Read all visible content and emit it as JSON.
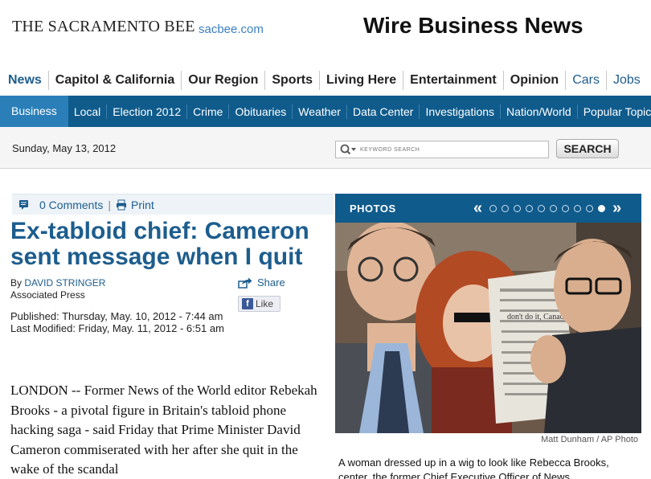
{
  "masthead": {
    "logo": "THE SACRAMENTO BEE",
    "logo_sub": "sacbee.com",
    "section_title": "Wire Business News"
  },
  "primary_nav": [
    {
      "label": "News"
    },
    {
      "label": "Capitol & California"
    },
    {
      "label": "Our Region"
    },
    {
      "label": "Sports"
    },
    {
      "label": "Living Here"
    },
    {
      "label": "Entertainment"
    },
    {
      "label": "Opinion"
    },
    {
      "label": "Cars"
    },
    {
      "label": "Jobs"
    }
  ],
  "secondary_nav": [
    {
      "label": "Business"
    },
    {
      "label": "Local"
    },
    {
      "label": "Election 2012"
    },
    {
      "label": "Crime"
    },
    {
      "label": "Obituaries"
    },
    {
      "label": "Weather"
    },
    {
      "label": "Data Center"
    },
    {
      "label": "Investigations"
    },
    {
      "label": "Nation/World"
    },
    {
      "label": "Popular Topics"
    }
  ],
  "datebar": {
    "date": "Sunday, May 13, 2012",
    "search_placeholder": "KEYWORD SEARCH",
    "search_button": "SEARCH"
  },
  "tools": {
    "comments": "0 Comments",
    "separator": "|",
    "print": "Print"
  },
  "article": {
    "headline": "Ex-tabloid chief: Cameron sent message when I quit",
    "by_prefix": "By ",
    "author": "DAVID STRINGER",
    "agency": "Associated Press",
    "published": "Published: Thursday, May. 10, 2012 - 7:44 am",
    "modified": "Last Modified: Friday, May. 11, 2012 - 6:51 am",
    "share_label": "Share",
    "like_label": "Like",
    "body": "LONDON -- Former News of the World editor Rebekah Brooks - a pivotal figure in Britain's tabloid phone hacking saga - said Friday that Prime Minister David Cameron commiserated with her after she quit in the wake of the scandal"
  },
  "photos": {
    "title": "PHOTOS",
    "dot_count": 10,
    "active_dot": 10,
    "credit": "Matt Dunham / AP Photo",
    "caption": "A woman dressed up in a wig to look like Rebecca Brooks, center, the former Chief Executive Officer of News",
    "newspaper_text": "don't do it, Canada"
  },
  "colors": {
    "brand_blue": "#0f5b8c",
    "link_blue": "#1d5d8e",
    "active_tab": "#2a7fb8"
  }
}
